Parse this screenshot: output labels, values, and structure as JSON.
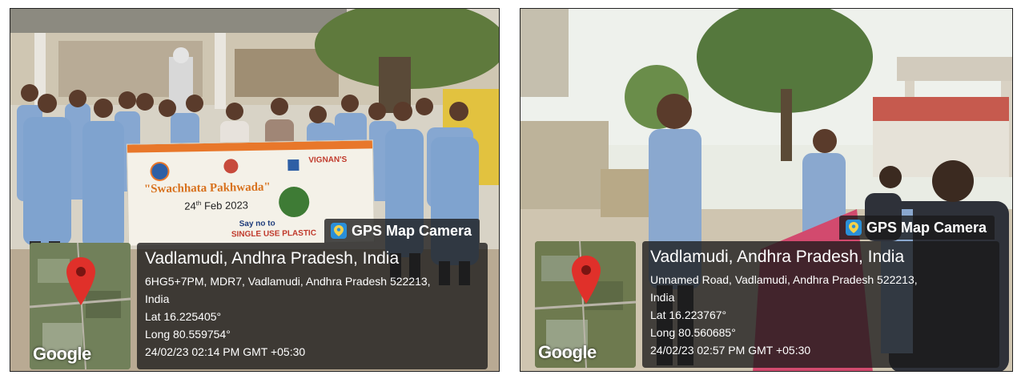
{
  "photos": [
    {
      "banner": {
        "title": "\"Swachhata Pakhwada\"",
        "date_day": "24",
        "date_sup": "th",
        "date_rest": "Feb 2023",
        "say_no": "Say no to",
        "single_use": "SINGLE USE PLASTIC",
        "org": "VIGNAN'S"
      },
      "camera_label": "GPS Map Camera",
      "location": "Vadlamudi, Andhra Pradesh, India",
      "address_1": "6HG5+7PM, MDR7, Vadlamudi, Andhra Pradesh 522213,",
      "address_2": "India",
      "lat": "Lat 16.225405°",
      "long": "Long 80.559754°",
      "timestamp": "24/02/23 02:14 PM GMT +05:30",
      "map_brand": "Google"
    },
    {
      "camera_label": "GPS Map Camera",
      "location": "Vadlamudi, Andhra Pradesh, India",
      "address_1": "Unnamed Road, Vadlamudi, Andhra Pradesh 522213,",
      "address_2": "India",
      "lat": "Lat 16.223767°",
      "long": "Long 80.560685°",
      "timestamp": "24/02/23 02:57 PM GMT +05:30",
      "map_brand": "Google"
    }
  ],
  "colors": {
    "overlay_bg": "#191919",
    "pin_red": "#e0302a",
    "shirt_blue": "#7fa3cf",
    "banner_orange": "#e8772a"
  }
}
